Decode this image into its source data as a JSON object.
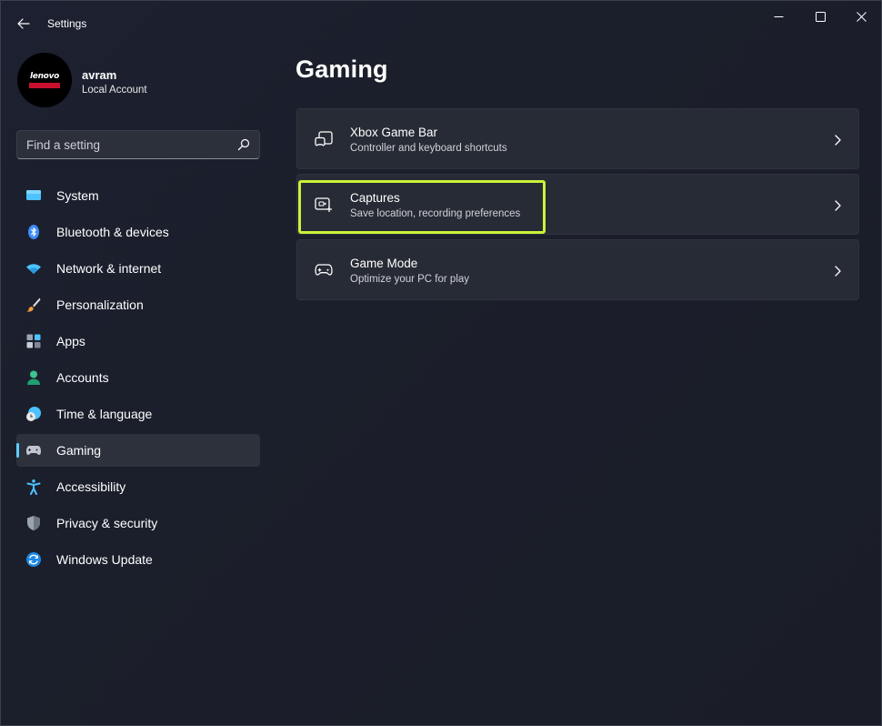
{
  "window": {
    "title": "Settings"
  },
  "profile": {
    "name": "avram",
    "account_type": "Local Account",
    "avatar_logo_text": "lenovo"
  },
  "search": {
    "placeholder": "Find a setting"
  },
  "nav": {
    "items": [
      {
        "label": "System",
        "icon": "monitor-icon"
      },
      {
        "label": "Bluetooth & devices",
        "icon": "bluetooth-icon"
      },
      {
        "label": "Network & internet",
        "icon": "wifi-icon"
      },
      {
        "label": "Personalization",
        "icon": "brush-icon"
      },
      {
        "label": "Apps",
        "icon": "apps-icon"
      },
      {
        "label": "Accounts",
        "icon": "person-icon"
      },
      {
        "label": "Time & language",
        "icon": "globe-clock-icon"
      },
      {
        "label": "Gaming",
        "icon": "gamepad-icon",
        "selected": true
      },
      {
        "label": "Accessibility",
        "icon": "accessibility-icon"
      },
      {
        "label": "Privacy & security",
        "icon": "shield-icon"
      },
      {
        "label": "Windows Update",
        "icon": "update-icon"
      }
    ]
  },
  "main": {
    "title": "Gaming",
    "cards": [
      {
        "title": "Xbox Game Bar",
        "subtitle": "Controller and keyboard shortcuts",
        "icon": "game-bar-icon"
      },
      {
        "title": "Captures",
        "subtitle": "Save location, recording preferences",
        "icon": "capture-icon",
        "highlighted": true
      },
      {
        "title": "Game Mode",
        "subtitle": "Optimize your PC for play",
        "icon": "gamepad-icon"
      }
    ]
  },
  "colors": {
    "accent": "#60cdff",
    "highlight": "#c9f33a",
    "card_bg": "#272b35",
    "selected_nav_bg": "#2d313c"
  }
}
